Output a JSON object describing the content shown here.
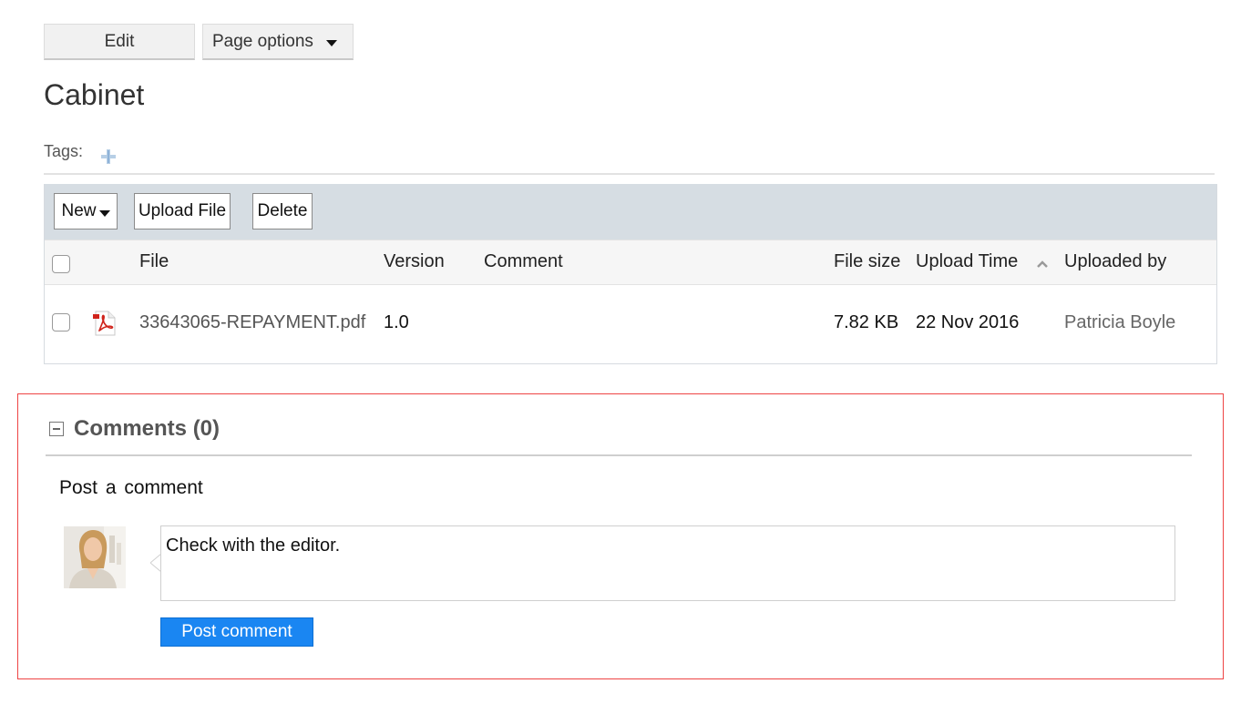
{
  "top_actions": {
    "edit_label": "Edit",
    "page_options_label": "Page options"
  },
  "page": {
    "title": "Cabinet",
    "tags_label": "Tags:"
  },
  "library": {
    "toolbar": {
      "new_label": "New",
      "upload_label": "Upload File",
      "delete_label": "Delete"
    },
    "columns": {
      "file": "File",
      "version": "Version",
      "comment": "Comment",
      "file_size": "File size",
      "upload_time": "Upload Time",
      "uploaded_by": "Uploaded by"
    },
    "rows": [
      {
        "file": "33643065-REPAYMENT.pdf",
        "version": "1.0",
        "comment": "",
        "file_size": "7.82 KB",
        "upload_time": "22 Nov 2016",
        "uploaded_by": "Patricia Boyle",
        "icon": "pdf-icon"
      }
    ]
  },
  "comments": {
    "title": "Comments (0)",
    "post_label": "Post a comment",
    "input_value": "Check with the editor.",
    "post_button": "Post comment"
  },
  "colors": {
    "accent_button": "#1a86f2",
    "toolbar_bg": "#d6dde3",
    "comments_border": "#ee4444"
  }
}
